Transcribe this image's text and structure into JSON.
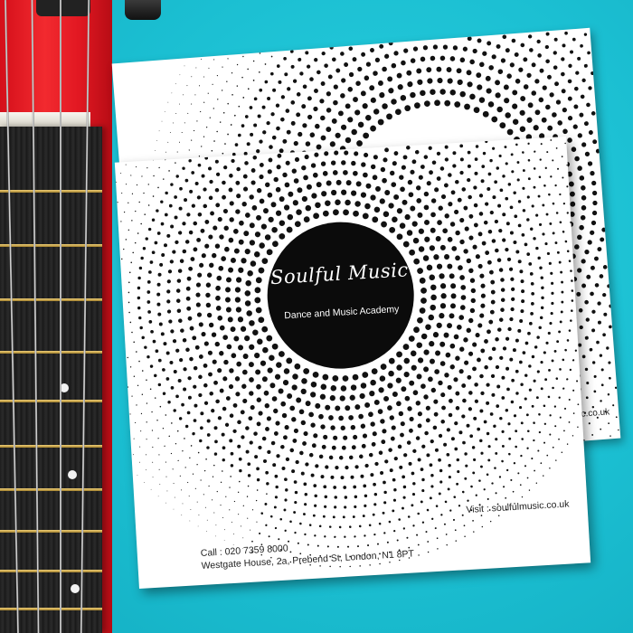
{
  "scene": {
    "background_color": "#1bbfd2",
    "guitar_color": "#e21822",
    "fretboard_color": "#1f1f1f",
    "fret_color": "#d9b25a"
  },
  "card": {
    "brand": "Soulful Music",
    "tagline": "Dance and Music Academy",
    "phone": "Call : 020 7359 8000",
    "address": "Westgate House, 2a, Prebend St, London, N1 8PT",
    "website": "Visit : soulfulmusic.co.uk",
    "back_website": "music.co.uk",
    "pattern": "halftone-dot-radial"
  }
}
